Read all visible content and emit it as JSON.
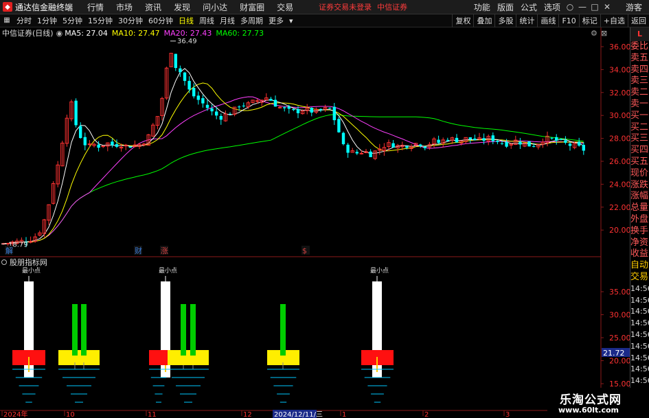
{
  "app": {
    "title": "通达信金融终端",
    "menu": [
      "行情",
      "市场",
      "资讯",
      "发现",
      "问小达",
      "财富圈",
      "交易"
    ],
    "login_status": "证券交易未登录",
    "broker": "中信证券",
    "right_menu": [
      "功能",
      "版面",
      "公式",
      "选项"
    ],
    "guest": "游客"
  },
  "toolbar": {
    "periods": [
      "分时",
      "1分钟",
      "5分钟",
      "15分钟",
      "30分钟",
      "60分钟",
      "日线",
      "周线",
      "月线",
      "多周期",
      "更多"
    ],
    "active_period": "日线",
    "right_buttons": [
      "复权",
      "叠加",
      "多股",
      "统计",
      "画线",
      "F10",
      "标记",
      "+自选",
      "返回"
    ]
  },
  "info": {
    "stock": "中信证券(日线)",
    "ma5": "MA5: 27.04",
    "ma10": "MA10: 27.47",
    "ma20": "MA20: 27.43",
    "ma60": "MA60: 27.73"
  },
  "colors": {
    "up": "#ff3232",
    "down": "#00ffff",
    "ma5": "#ffffff",
    "ma10": "#ffff00",
    "ma20": "#ff40ff",
    "ma60": "#00ff00",
    "axis_label": "#ff3232"
  },
  "price_axis": [
    "36.00",
    "34.00",
    "32.00",
    "30.00",
    "28.00",
    "26.00",
    "24.00",
    "22.00",
    "20.00"
  ],
  "price_high_label": "36.49",
  "price_low_label": "18.79",
  "event_markers": [
    "解",
    "财",
    "涨",
    "$"
  ],
  "indicator": {
    "name": "股朋指标网",
    "axis": [
      "35.00",
      "30.00",
      "25.00",
      "20.00",
      "15.00"
    ],
    "current_value": "21.72",
    "signal_label": "最小点"
  },
  "date_axis": [
    "2024年",
    "10",
    "11",
    "12",
    "2024/12/11/三",
    "1",
    "2",
    "3"
  ],
  "right_panel": {
    "head": "L",
    "items": [
      "委比",
      "卖五",
      "卖四",
      "卖三",
      "卖二",
      "卖一",
      "买一",
      "买二",
      "买三",
      "买四",
      "买五",
      "现价",
      "涨跌",
      "涨幅",
      "总量",
      "外盘",
      "换手",
      "净资",
      "收益",
      "自动",
      "交易"
    ],
    "times": [
      "14:56",
      "14:56",
      "14:56",
      "14:56",
      "14:56",
      "14:56",
      "14:56",
      "14:56",
      "14:56",
      "14:56"
    ]
  },
  "watermark": {
    "line1": "乐淘公式网",
    "line2": "www.60lt.com"
  }
}
